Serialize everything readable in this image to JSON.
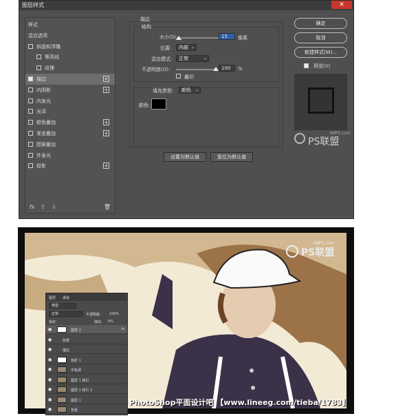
{
  "dialog": {
    "title": "图层样式",
    "close": "✕",
    "styles_list": [
      {
        "label": "样式",
        "checkbox": false,
        "checked": false,
        "plus": false
      },
      {
        "label": "混合选项",
        "checkbox": false,
        "checked": false,
        "plus": false
      },
      {
        "label": "斜面和浮雕",
        "checkbox": true,
        "checked": false,
        "plus": false
      },
      {
        "label": "等高线",
        "checkbox": true,
        "checked": false,
        "plus": false
      },
      {
        "label": "纹理",
        "checkbox": true,
        "checked": false,
        "plus": false
      },
      {
        "label": "描边",
        "checkbox": true,
        "checked": true,
        "plus": true,
        "selected": true
      },
      {
        "label": "内阴影",
        "checkbox": true,
        "checked": false,
        "plus": true
      },
      {
        "label": "内发光",
        "checkbox": true,
        "checked": false,
        "plus": false
      },
      {
        "label": "光泽",
        "checkbox": true,
        "checked": false,
        "plus": false
      },
      {
        "label": "颜色叠加",
        "checkbox": true,
        "checked": false,
        "plus": true
      },
      {
        "label": "渐变叠加",
        "checkbox": true,
        "checked": false,
        "plus": true
      },
      {
        "label": "图案叠加",
        "checkbox": true,
        "checked": false,
        "plus": false
      },
      {
        "label": "外发光",
        "checkbox": true,
        "checked": false,
        "plus": false
      },
      {
        "label": "投影",
        "checkbox": true,
        "checked": false,
        "plus": true
      }
    ],
    "footer": {
      "fx": "fx",
      "up": "⇧",
      "down": "⇩",
      "trash": "🗑"
    },
    "stroke": {
      "section_title": "描边",
      "structure_title": "结构",
      "size_label": "大小(S):",
      "size_value": "15",
      "size_unit": "像素",
      "position_label": "位置:",
      "position_value": "内部",
      "blend_label": "混合模式:",
      "blend_value": "正常",
      "opacity_label": "不透明度(O):",
      "opacity_value": "100",
      "opacity_unit": "%",
      "overprint_label": "叠印",
      "fill_type_label": "填充类型:",
      "fill_type_value": "颜色",
      "color_label": "颜色:",
      "color_swatch": "#000000",
      "default_btn": "设置为默认值",
      "reset_btn": "复位为默认值"
    },
    "buttons": {
      "ok": "确定",
      "cancel": "取消",
      "new_style": "新建样式(W)...",
      "preview": "预览(V)"
    },
    "watermark": {
      "site": "68PS.com",
      "brand": "PS联盟"
    }
  },
  "photo": {
    "watermark": {
      "site": "68PS.com",
      "brand": "PS联盟"
    },
    "caption": "PhotoShop平面设计吧 【www.lineeg.com/tieba/1783】",
    "layers_panel": {
      "tabs": [
        "图层",
        "通道"
      ],
      "kind": "类型",
      "blend": "正常",
      "opacity_label": "不透明度:",
      "opacity": "100%",
      "lock_label": "锁定:",
      "fill_label": "填充:",
      "fill": "0%",
      "layers": [
        {
          "name": "图层 2",
          "fx": "fx"
        },
        {
          "name": "效果"
        },
        {
          "name": "描边"
        },
        {
          "name": "色阶 1"
        },
        {
          "name": "中色调"
        },
        {
          "name": "图层 1 拷贝"
        },
        {
          "name": "图层 1 拷贝 2"
        },
        {
          "name": "图层 1"
        },
        {
          "name": "背景"
        }
      ]
    }
  }
}
